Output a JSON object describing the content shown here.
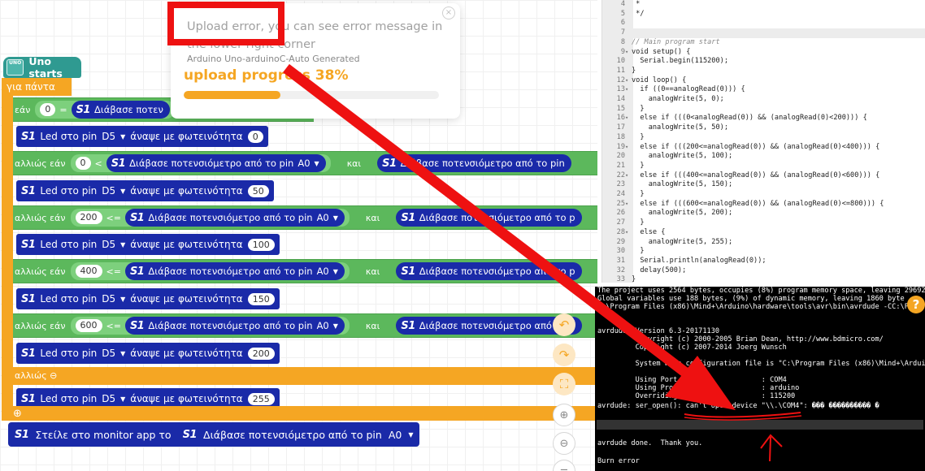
{
  "blocks": {
    "hat_icon": "UNO",
    "hat_label": "Uno starts",
    "forever_label": "για πάντα",
    "if_label": "εάν",
    "elseif_label": "αλλιώς εάν",
    "else_label": "αλλιώς",
    "and_label": "και",
    "s1": "S1",
    "read_pot_label": "Διάβασε ποτενσιόμετρο από το pin",
    "read_pot_truncated": "Διάβασε ποτεν",
    "read_pot_r1": "Διάβασε ποτενσιόμετρο από το pin",
    "read_pot_r2": "Διάβασε ποτενσιόμετρο από το p",
    "read_pot_r3": "Διάβασε ποτενσιόμετρο από το p",
    "read_pot_r4": "Διάβασε ποτενσιόμετρο από το p",
    "pin_a0": "A0",
    "led_label": "Led στο pin",
    "pin_d5": "D5",
    "led_on_label": "άναψε με φωτεινότητα",
    "op_eq": "=",
    "op_lt": "<",
    "op_le": "<=",
    "v0": "0",
    "v50": "50",
    "v100": "100",
    "v150": "150",
    "v200": "200",
    "v255": "255",
    "v400": "400",
    "v600": "600",
    "monitor_label": "Στείλε στο monitor app το",
    "minus_icon": "⊖",
    "plus_icon": "⊕"
  },
  "popup": {
    "message": "Upload error, you can see error message in the lower right corner",
    "subtitle": "Arduino Uno-arduinoC-Auto Generated",
    "progress_text": "upload progress 38%",
    "progress": 38,
    "close": "×"
  },
  "code": [
    {
      "n": "4",
      "t": " *"
    },
    {
      "n": "5",
      "t": " */"
    },
    {
      "n": "6",
      "t": ""
    },
    {
      "n": "7",
      "t": ""
    },
    {
      "n": "8",
      "t": "// Main program start"
    },
    {
      "n": "9",
      "t": "void setup() {",
      "fold": true
    },
    {
      "n": "10",
      "t": "  Serial.begin(115200);"
    },
    {
      "n": "11",
      "t": "}"
    },
    {
      "n": "12",
      "t": "void loop() {",
      "fold": true
    },
    {
      "n": "13",
      "t": "  if ((0==analogRead(0))) {",
      "fold": true
    },
    {
      "n": "14",
      "t": "    analogWrite(5, 0);"
    },
    {
      "n": "15",
      "t": "  }"
    },
    {
      "n": "16",
      "t": "  else if (((0<analogRead(0)) && (analogRead(0)<200))) {",
      "fold": true
    },
    {
      "n": "17",
      "t": "    analogWrite(5, 50);"
    },
    {
      "n": "18",
      "t": "  }"
    },
    {
      "n": "19",
      "t": "  else if (((200<=analogRead(0)) && (analogRead(0)<400))) {",
      "fold": true
    },
    {
      "n": "20",
      "t": "    analogWrite(5, 100);"
    },
    {
      "n": "21",
      "t": "  }"
    },
    {
      "n": "22",
      "t": "  else if (((400<=analogRead(0)) && (analogRead(0)<600))) {",
      "fold": true
    },
    {
      "n": "23",
      "t": "    analogWrite(5, 150);"
    },
    {
      "n": "24",
      "t": "  }"
    },
    {
      "n": "25",
      "t": "  else if (((600<=analogRead(0)) && (analogRead(0)<=800))) {",
      "fold": true
    },
    {
      "n": "26",
      "t": "    analogWrite(5, 200);"
    },
    {
      "n": "27",
      "t": "  }"
    },
    {
      "n": "28",
      "t": "  else {",
      "fold": true
    },
    {
      "n": "29",
      "t": "    analogWrite(5, 255);"
    },
    {
      "n": "30",
      "t": "  }"
    },
    {
      "n": "31",
      "t": "  Serial.println(analogRead(0));"
    },
    {
      "n": "32",
      "t": "  delay(500);"
    },
    {
      "n": "33",
      "t": "}"
    }
  ],
  "console": {
    "lines": [
      "The project uses 2564 bytes, occupies (8%) program memory space, leaving 29692",
      "Global variables use 188 bytes, (9%) of dynamic memory, leaving 1860 byte",
      "C:\\Program Files (x86)\\Mind+\\Arduino\\hardware\\tools\\avr\\bin\\avrdude -CC:\\Pr",
      "",
      "avrdude: Version 6.3-20171130",
      "         Copyright (c) 2000-2005 Brian Dean, http://www.bdmicro.com/",
      "         Copyright (c) 2007-2014 Joerg Wunsch",
      "",
      "         System wide configuration file is \"C:\\Program Files (x86)\\Mind+\\Arduin",
      "",
      "         Using Port                    : COM4",
      "         Using Programmer              : arduino",
      "         Overriding Baud Rate          : 115200",
      "avrdude: ser_open(): can't open device \"\\\\.\\COM4\": ��� ���������� �",
      "",
      "",
      "",
      "avrdude done.  Thank you.",
      "",
      "Burn error"
    ],
    "help": "?"
  },
  "icons": {
    "undo": "↶",
    "redo": "↷",
    "crop": "⛶",
    "zoom_in": "⊕",
    "zoom_out": "⊖",
    "reset": "="
  },
  "colors": {
    "control_orange": "#f5a623",
    "logic_green": "#5cb85c",
    "sensor_blue": "#1a2aa8",
    "hat_teal": "#2f9a91",
    "annotation_red": "#ee1111"
  }
}
